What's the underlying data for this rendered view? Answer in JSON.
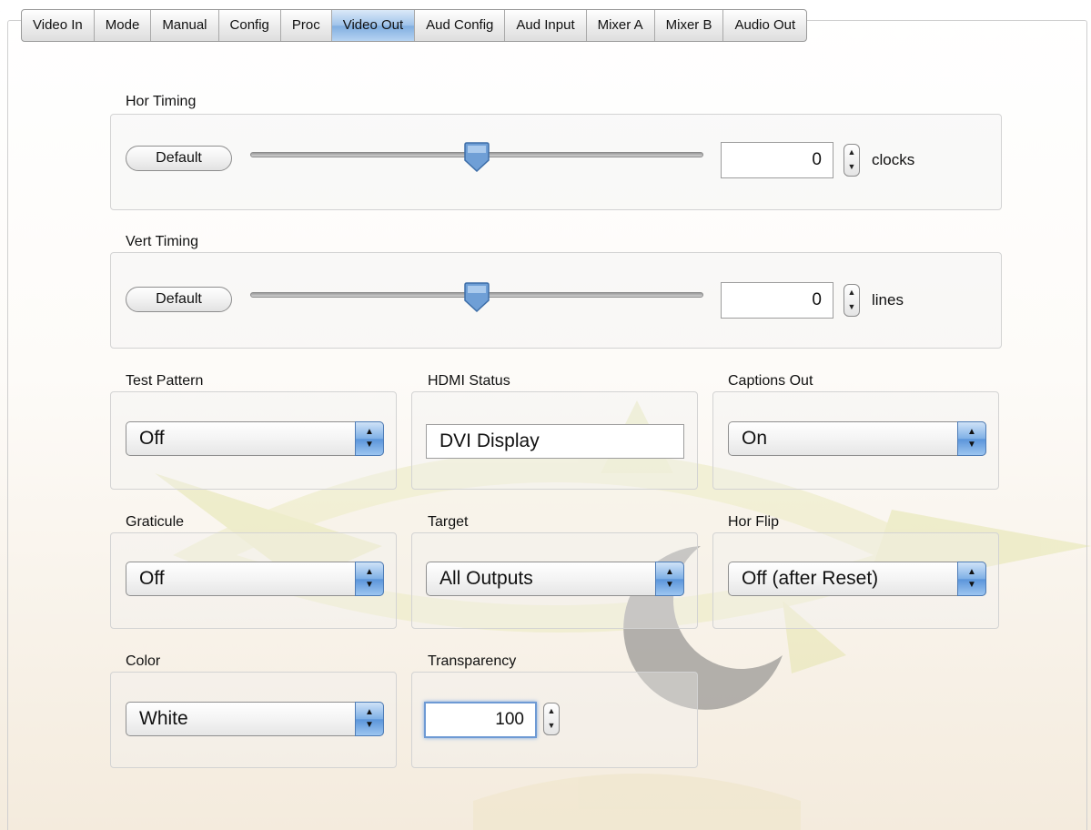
{
  "tabs": [
    "Video In",
    "Mode",
    "Manual",
    "Config",
    "Proc",
    "Video Out",
    "Aud Config",
    "Aud Input",
    "Mixer A",
    "Mixer B",
    "Audio Out"
  ],
  "active_tab": "Video Out",
  "hor_timing": {
    "label": "Hor Timing",
    "default_button": "Default",
    "slider_fraction": 0.5,
    "value": "0",
    "unit": "clocks"
  },
  "vert_timing": {
    "label": "Vert Timing",
    "default_button": "Default",
    "slider_fraction": 0.5,
    "value": "0",
    "unit": "lines"
  },
  "test_pattern": {
    "label": "Test Pattern",
    "value": "Off"
  },
  "hdmi_status": {
    "label": "HDMI Status",
    "value": "DVI Display"
  },
  "captions_out": {
    "label": "Captions Out",
    "value": "On"
  },
  "graticule": {
    "label": "Graticule",
    "value": "Off"
  },
  "target": {
    "label": "Target",
    "value": "All Outputs"
  },
  "hor_flip": {
    "label": "Hor Flip",
    "value": "Off (after Reset)"
  },
  "color": {
    "label": "Color",
    "value": "White"
  },
  "transparency": {
    "label": "Transparency",
    "value": "100"
  },
  "icons": {
    "stepper": "up-down-stepper-icon",
    "popup_arrows": "popup-arrows-icon",
    "slider_thumb": "slider-thumb-icon",
    "watermark": "eye-logo-watermark"
  },
  "colors": {
    "accent_blue": "#7fb0e6",
    "watermark_yellow": "#e9eab4",
    "watermark_gray": "#7d7d7d"
  }
}
